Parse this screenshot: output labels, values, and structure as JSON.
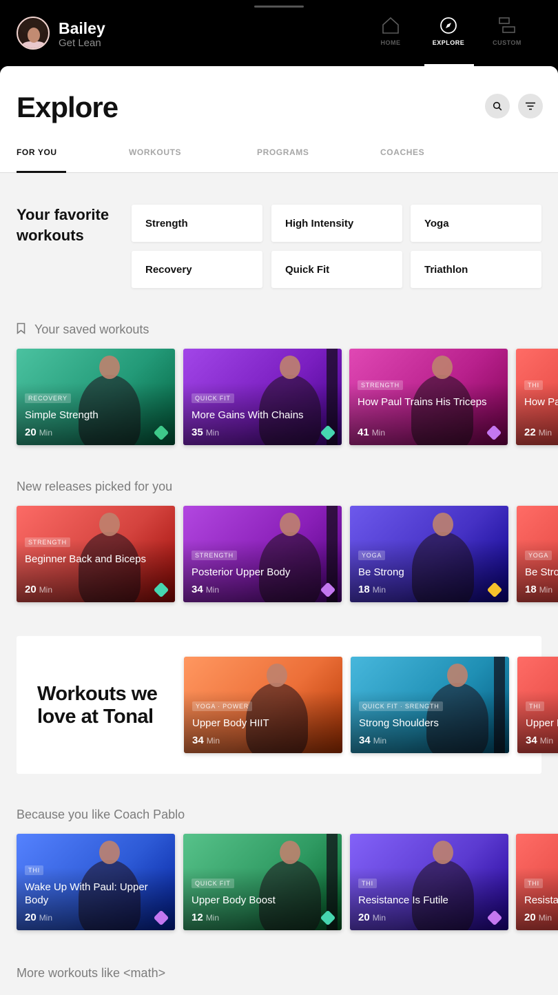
{
  "user": {
    "name": "Bailey",
    "plan": "Get Lean"
  },
  "nav": [
    {
      "label": "HOME",
      "icon": "home-icon",
      "active": false
    },
    {
      "label": "EXPLORE",
      "icon": "compass-icon",
      "active": true
    },
    {
      "label": "CUSTOM",
      "icon": "custom-icon",
      "active": false
    }
  ],
  "page": {
    "title": "Explore"
  },
  "tabs": [
    {
      "label": "FOR YOU",
      "active": true
    },
    {
      "label": "WORKOUTS",
      "active": false
    },
    {
      "label": "PROGRAMS",
      "active": false
    },
    {
      "label": "COACHES",
      "active": false
    }
  ],
  "favorites": {
    "title": "Your favorite workouts",
    "items": [
      "Strength",
      "High Intensity",
      "Yoga",
      "Recovery",
      "Quick Fit",
      "Triathlon"
    ]
  },
  "saved": {
    "title": "Your saved workouts",
    "cards": [
      {
        "tag": "RECOVERY",
        "title": "Simple Strength",
        "minutes": "20",
        "unit": "Min",
        "level_color": "#3ec98a",
        "bg": "#239a78"
      },
      {
        "tag": "QUICK FIT",
        "title": "More Gains With Chains",
        "minutes": "35",
        "unit": "Min",
        "level_color": "#46d6b0",
        "bg": "#7a1ec0"
      },
      {
        "tag": "STRENGTH",
        "title": "How Paul Trains His Triceps",
        "minutes": "41",
        "unit": "Min",
        "level_color": "#c477f0",
        "bg": "#b8208c"
      },
      {
        "tag": "THI",
        "title": "How Paul Trains His Triceps",
        "minutes": "22",
        "unit": "Min",
        "level_color": "#c477f0",
        "bg": "#e0443e"
      }
    ]
  },
  "new_releases": {
    "title": "New releases picked for you",
    "cards": [
      {
        "tag": "STRENGTH",
        "title": "Beginner Back and Biceps",
        "minutes": "20",
        "unit": "Min",
        "level_color": "#46d6b0",
        "bg": "#d4433e"
      },
      {
        "tag": "STRENGTH",
        "title": "Posterior Upper Body",
        "minutes": "34",
        "unit": "Min",
        "level_color": "#c477f0",
        "bg": "#8a1fb8"
      },
      {
        "tag": "YOGA",
        "title": "Be Strong",
        "minutes": "18",
        "unit": "Min",
        "level_color": "#f6c12b",
        "bg": "#4531c4"
      },
      {
        "tag": "YOGA",
        "title": "Be Strong",
        "minutes": "18",
        "unit": "Min",
        "level_color": "#f6c12b",
        "bg": "#e0443e"
      }
    ]
  },
  "promo": {
    "title": "Workouts we love at Tonal",
    "cards": [
      {
        "tag": "YOGA · POWER",
        "title": "Upper Body HIIT",
        "minutes": "34",
        "unit": "Min",
        "bg": "#ec6f38"
      },
      {
        "tag": "QUICK FIT · SRENGTH",
        "title": "Strong Shoulders",
        "minutes": "34",
        "unit": "Min",
        "bg": "#1f8fb4"
      },
      {
        "tag": "THI",
        "title": "Upper Body HIIT",
        "minutes": "34",
        "unit": "Min",
        "bg": "#e0443e"
      }
    ]
  },
  "coach": {
    "title": "Because you like Coach Pablo",
    "cards": [
      {
        "tag": "THI",
        "title": "Wake Up With Paul: Upper Body",
        "minutes": "20",
        "unit": "Min",
        "level_color": "#c477f0",
        "bg": "#2d5ad6"
      },
      {
        "tag": "QUICK FIT",
        "title": "Upper Body Boost",
        "minutes": "12",
        "unit": "Min",
        "level_color": "#46d6b0",
        "bg": "#2f9a62"
      },
      {
        "tag": "THI",
        "title": "Resistance Is Futile",
        "minutes": "20",
        "unit": "Min",
        "level_color": "#c477f0",
        "bg": "#5b3ad0"
      },
      {
        "tag": "THI",
        "title": "Resistance Is Futile",
        "minutes": "20",
        "unit": "Min",
        "level_color": "#c477f0",
        "bg": "#e0443e"
      }
    ]
  },
  "more": {
    "title": "More workouts like <math>"
  }
}
